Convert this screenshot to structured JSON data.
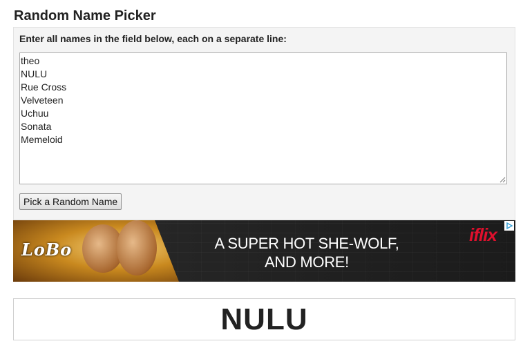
{
  "page": {
    "title": "Random Name Picker"
  },
  "form": {
    "instruction": "Enter all names in the field below, each on a separate line:",
    "names": [
      "theo",
      "NULU",
      "Rue Cross",
      "Velveteen",
      "Uchuu",
      "Sonata",
      "Memeloid"
    ],
    "pick_button_label": "Pick a Random Name"
  },
  "ad": {
    "logo_text": "LoBo",
    "headline_line1": "A SUPER HOT SHE-WOLF,",
    "headline_line2": "AND MORE!",
    "brand": "iflix",
    "brand_color": "#e0102d"
  },
  "result": {
    "picked_name": "NULU"
  }
}
